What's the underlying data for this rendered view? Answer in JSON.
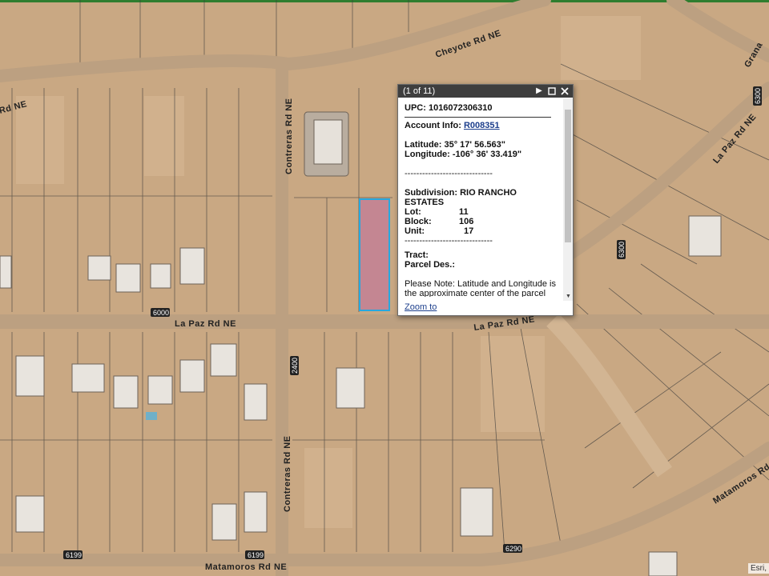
{
  "map": {
    "roads": {
      "cheyote": "Cheyote Rd NE",
      "contreras_upper": "Contreras Rd NE",
      "contreras_lower": "Contreras Rd NE",
      "lapaz_west": "La Paz Rd NE",
      "lapaz_east": "La Paz Rd NE",
      "lapaz_ne": "La Paz Rd NE",
      "matamoros_west": "Matamoros Rd NE",
      "matamoros_east": "Matamoros Rd NE",
      "road_left_top": "Rd NE",
      "granada_partial": "Grana"
    },
    "house_numbers": [
      "6000",
      "2400",
      "6199",
      "6199",
      "6290",
      "6300",
      "6300"
    ],
    "attribution": "Esri,"
  },
  "popup": {
    "title": "(1 of 11)",
    "upc_label": "UPC:",
    "upc_value": "1016072306310",
    "account_label": "Account Info:",
    "account_value": "R008351",
    "latitude": "Latitude: 35° 17' 56.563\"",
    "longitude": "Longitude: -106° 36' 33.419\"",
    "divider": "------------------------------",
    "subdivision_label": "Subdivision:",
    "subdivision_value": "RIO RANCHO",
    "subdivision_value2": "ESTATES",
    "lot_label": "Lot:",
    "lot_value": "11",
    "block_label": "Block:",
    "block_value": "106",
    "unit_label": "Unit:",
    "unit_value": "17",
    "tract_label": "Tract:",
    "parcel_label": "Parcel Des.:",
    "note": "Please Note: Latitude and Longitude is the approximate center of the parcel shown.",
    "zoom": "Zoom to"
  }
}
